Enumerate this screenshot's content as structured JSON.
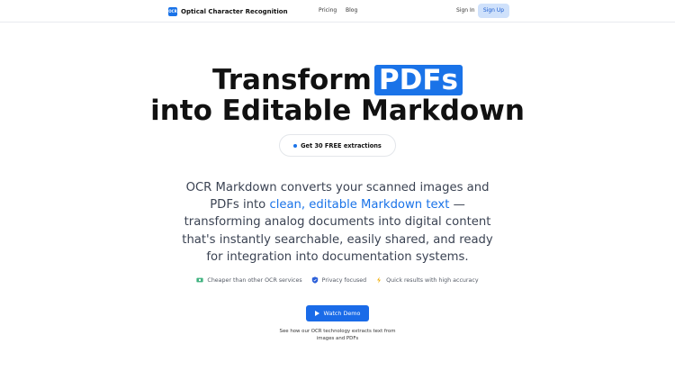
{
  "nav": {
    "brand_logo_text": "OCR",
    "brand": "Optical Character Recognition",
    "links": [
      "Pricing",
      "Blog"
    ],
    "sign_in": "Sign In",
    "sign_up": "Sign Up"
  },
  "hero": {
    "title_prefix": "Transform",
    "title_highlight": "PDFs",
    "title_line2": "into Editable Markdown",
    "badge": "Get 30 FREE extractions",
    "description_before": "OCR Markdown converts your scanned images and PDFs into ",
    "description_link": "clean, editable Markdown text",
    "description_after": " — transforming analog documents into digital content that's instantly searchable, easily shared, and ready for integration into documentation systems.",
    "features": [
      {
        "icon": "money-icon",
        "label": "Cheaper than other OCR services"
      },
      {
        "icon": "shield-icon",
        "label": "Privacy focused"
      },
      {
        "icon": "lightning-icon",
        "label": "Quick results with high accuracy"
      }
    ],
    "watch_demo": "Watch Demo",
    "caption": "See how our OCR technology extracts text from images and PDFs"
  },
  "colors": {
    "accent": "#1a73e8",
    "signup_bg": "#cfe1fb",
    "body_text": "#3b4353"
  }
}
